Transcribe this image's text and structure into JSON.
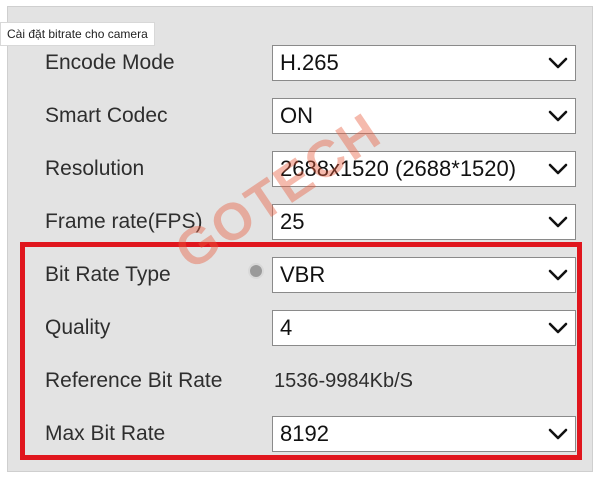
{
  "caption": "Cài đặt bitrate cho camera",
  "watermark": "GOTECH",
  "colors": {
    "highlight": "#e0161e",
    "panel": "#e3e3e3"
  },
  "fields": [
    {
      "label": "Encode Mode",
      "value": "H.265"
    },
    {
      "label": "Smart Codec",
      "value": "ON"
    },
    {
      "label": "Resolution",
      "value": "2688x1520 (2688*1520)"
    },
    {
      "label": "Frame rate(FPS)",
      "value": "25"
    },
    {
      "label": "Bit Rate Type",
      "value": "VBR"
    },
    {
      "label": "Quality",
      "value": "4"
    },
    {
      "label": "Reference Bit Rate",
      "value": "1536-9984Kb/S"
    },
    {
      "label": "Max Bit Rate",
      "value": "8192"
    }
  ]
}
